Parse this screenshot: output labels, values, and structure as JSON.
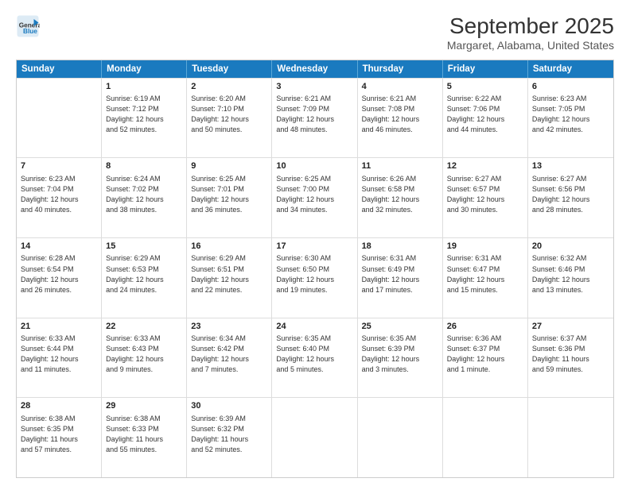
{
  "logo": {
    "line1": "General",
    "line2": "Blue"
  },
  "title": "September 2025",
  "subtitle": "Margaret, Alabama, United States",
  "days_of_week": [
    "Sunday",
    "Monday",
    "Tuesday",
    "Wednesday",
    "Thursday",
    "Friday",
    "Saturday"
  ],
  "weeks": [
    [
      {
        "day": "",
        "sunrise": "",
        "sunset": "",
        "daylight": ""
      },
      {
        "day": "1",
        "sunrise": "6:19 AM",
        "sunset": "7:12 PM",
        "daylight": "12 hours and 52 minutes."
      },
      {
        "day": "2",
        "sunrise": "6:20 AM",
        "sunset": "7:10 PM",
        "daylight": "12 hours and 50 minutes."
      },
      {
        "day": "3",
        "sunrise": "6:21 AM",
        "sunset": "7:09 PM",
        "daylight": "12 hours and 48 minutes."
      },
      {
        "day": "4",
        "sunrise": "6:21 AM",
        "sunset": "7:08 PM",
        "daylight": "12 hours and 46 minutes."
      },
      {
        "day": "5",
        "sunrise": "6:22 AM",
        "sunset": "7:06 PM",
        "daylight": "12 hours and 44 minutes."
      },
      {
        "day": "6",
        "sunrise": "6:23 AM",
        "sunset": "7:05 PM",
        "daylight": "12 hours and 42 minutes."
      }
    ],
    [
      {
        "day": "7",
        "sunrise": "6:23 AM",
        "sunset": "7:04 PM",
        "daylight": "12 hours and 40 minutes."
      },
      {
        "day": "8",
        "sunrise": "6:24 AM",
        "sunset": "7:02 PM",
        "daylight": "12 hours and 38 minutes."
      },
      {
        "day": "9",
        "sunrise": "6:25 AM",
        "sunset": "7:01 PM",
        "daylight": "12 hours and 36 minutes."
      },
      {
        "day": "10",
        "sunrise": "6:25 AM",
        "sunset": "7:00 PM",
        "daylight": "12 hours and 34 minutes."
      },
      {
        "day": "11",
        "sunrise": "6:26 AM",
        "sunset": "6:58 PM",
        "daylight": "12 hours and 32 minutes."
      },
      {
        "day": "12",
        "sunrise": "6:27 AM",
        "sunset": "6:57 PM",
        "daylight": "12 hours and 30 minutes."
      },
      {
        "day": "13",
        "sunrise": "6:27 AM",
        "sunset": "6:56 PM",
        "daylight": "12 hours and 28 minutes."
      }
    ],
    [
      {
        "day": "14",
        "sunrise": "6:28 AM",
        "sunset": "6:54 PM",
        "daylight": "12 hours and 26 minutes."
      },
      {
        "day": "15",
        "sunrise": "6:29 AM",
        "sunset": "6:53 PM",
        "daylight": "12 hours and 24 minutes."
      },
      {
        "day": "16",
        "sunrise": "6:29 AM",
        "sunset": "6:51 PM",
        "daylight": "12 hours and 22 minutes."
      },
      {
        "day": "17",
        "sunrise": "6:30 AM",
        "sunset": "6:50 PM",
        "daylight": "12 hours and 19 minutes."
      },
      {
        "day": "18",
        "sunrise": "6:31 AM",
        "sunset": "6:49 PM",
        "daylight": "12 hours and 17 minutes."
      },
      {
        "day": "19",
        "sunrise": "6:31 AM",
        "sunset": "6:47 PM",
        "daylight": "12 hours and 15 minutes."
      },
      {
        "day": "20",
        "sunrise": "6:32 AM",
        "sunset": "6:46 PM",
        "daylight": "12 hours and 13 minutes."
      }
    ],
    [
      {
        "day": "21",
        "sunrise": "6:33 AM",
        "sunset": "6:44 PM",
        "daylight": "12 hours and 11 minutes."
      },
      {
        "day": "22",
        "sunrise": "6:33 AM",
        "sunset": "6:43 PM",
        "daylight": "12 hours and 9 minutes."
      },
      {
        "day": "23",
        "sunrise": "6:34 AM",
        "sunset": "6:42 PM",
        "daylight": "12 hours and 7 minutes."
      },
      {
        "day": "24",
        "sunrise": "6:35 AM",
        "sunset": "6:40 PM",
        "daylight": "12 hours and 5 minutes."
      },
      {
        "day": "25",
        "sunrise": "6:35 AM",
        "sunset": "6:39 PM",
        "daylight": "12 hours and 3 minutes."
      },
      {
        "day": "26",
        "sunrise": "6:36 AM",
        "sunset": "6:37 PM",
        "daylight": "12 hours and 1 minute."
      },
      {
        "day": "27",
        "sunrise": "6:37 AM",
        "sunset": "6:36 PM",
        "daylight": "11 hours and 59 minutes."
      }
    ],
    [
      {
        "day": "28",
        "sunrise": "6:38 AM",
        "sunset": "6:35 PM",
        "daylight": "11 hours and 57 minutes."
      },
      {
        "day": "29",
        "sunrise": "6:38 AM",
        "sunset": "6:33 PM",
        "daylight": "11 hours and 55 minutes."
      },
      {
        "day": "30",
        "sunrise": "6:39 AM",
        "sunset": "6:32 PM",
        "daylight": "11 hours and 52 minutes."
      },
      {
        "day": "",
        "sunrise": "",
        "sunset": "",
        "daylight": ""
      },
      {
        "day": "",
        "sunrise": "",
        "sunset": "",
        "daylight": ""
      },
      {
        "day": "",
        "sunrise": "",
        "sunset": "",
        "daylight": ""
      },
      {
        "day": "",
        "sunrise": "",
        "sunset": "",
        "daylight": ""
      }
    ]
  ]
}
